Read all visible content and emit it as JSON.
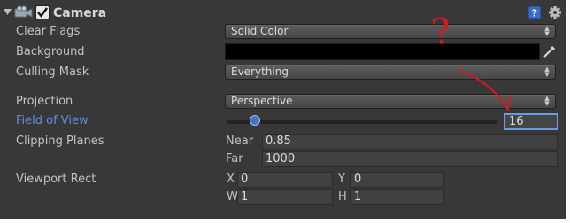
{
  "component": {
    "title": "Camera",
    "enabled": true
  },
  "icons": {
    "foldout": "triangle-down-icon",
    "component": "camera-icon",
    "checkbox": "checkbox-checked-icon",
    "help": "help-book-icon",
    "settings": "gear-icon",
    "eyedropper": "eyedropper-icon",
    "arrow": "dropdown-arrows-icon"
  },
  "properties": {
    "clear_flags": {
      "label": "Clear Flags",
      "value": "Solid Color"
    },
    "background": {
      "label": "Background",
      "color": "#000000"
    },
    "culling_mask": {
      "label": "Culling Mask",
      "value": "Everything"
    },
    "projection": {
      "label": "Projection",
      "value": "Perspective"
    },
    "field_of_view": {
      "label": "Field of View",
      "value": "16",
      "slider_fraction": 0.087
    },
    "clipping_planes": {
      "label": "Clipping Planes",
      "near_label": "Near",
      "near_value": "0.85",
      "far_label": "Far",
      "far_value": "1000"
    },
    "viewport_rect": {
      "label": "Viewport Rect",
      "x_label": "X",
      "x_value": "0",
      "y_label": "Y",
      "y_value": "0",
      "w_label": "W",
      "w_value": "1",
      "h_label": "H",
      "h_value": "1"
    }
  },
  "annotation": {
    "question": "?",
    "color": "#d41b1b"
  },
  "colors": {
    "panel_bg": "#383838",
    "label": "#c4c4c4",
    "active_label": "#5d8fe8",
    "focus_border": "#6a9be8"
  }
}
